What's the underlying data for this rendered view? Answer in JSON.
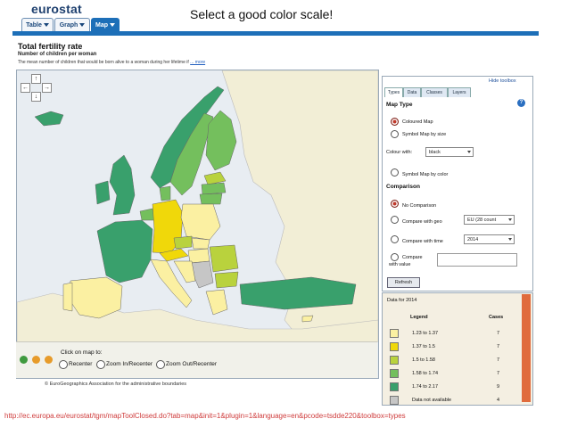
{
  "overlay_title": "Select a good color scale!",
  "app": {
    "logo": "eurostat"
  },
  "tabs": [
    {
      "label": "Table",
      "active": false
    },
    {
      "label": "Graph",
      "active": false
    },
    {
      "label": "Map",
      "active": true
    }
  ],
  "dataset": {
    "title": "Total fertility rate",
    "subtitle": "Number of children per woman",
    "description": "The mean number of children that would be born alive to a woman during her lifetime if",
    "more_link": "... more"
  },
  "map_controls": {
    "click_prompt": "Click on map to:",
    "options": [
      "Recenter",
      "Zoom In/Recenter",
      "Zoom Out/Recenter"
    ],
    "copyright": "© EuroGeographics Association for the administrative boundaries"
  },
  "toolbox": {
    "hide_label": "Hide toolbox",
    "tabs": [
      "Types",
      "Data",
      "Classes",
      "Layers"
    ],
    "map_type_heading": "Map Type",
    "coloured_map": "Coloured Map",
    "symbol_map_size": "Symbol Map by size",
    "colour_with_label": "Colour with:",
    "colour_with_value": "black",
    "symbol_map_color": "Symbol Map by color",
    "comparison_heading": "Comparison",
    "no_comparison": "No Comparison",
    "compare_geo": "Compare with geo",
    "compare_geo_value": "EU (28 count",
    "compare_time": "Compare with time",
    "compare_time_value": "2014",
    "compare_value_line1": "Compare",
    "compare_value_line2": "with value",
    "refresh": "Refresh",
    "help": "?"
  },
  "legend": {
    "title": "Data for 2014",
    "col_legend": "Legend",
    "col_cases": "Cases",
    "rows": [
      {
        "range": "1.23  to  1.37",
        "cases": "7",
        "color": "#fbf0a2"
      },
      {
        "range": "1.37  to    1.5",
        "cases": "7",
        "color": "#f0d80a"
      },
      {
        "range": "1.5  to  1.58",
        "cases": "7",
        "color": "#b9d23d"
      },
      {
        "range": "1.58  to  1.74",
        "cases": "7",
        "color": "#74bf5d"
      },
      {
        "range": "1.74  to  2.17",
        "cases": "9",
        "color": "#39a06c"
      },
      {
        "range": "Data not available",
        "cases": "4",
        "color": "#c6c6c6"
      }
    ]
  },
  "source_url": "http://ec.europa.eu/eurostat/tgm/mapToolClosed.do?tab=map&init=1&plugin=1&language=en&pcode=tsdde220&toolbox=types",
  "colors": {
    "brand_blue": "#1d6fb8",
    "sea": "#e8edf2",
    "non_eu_land": "#f2eed6",
    "no_data": "#c6c6c6"
  }
}
